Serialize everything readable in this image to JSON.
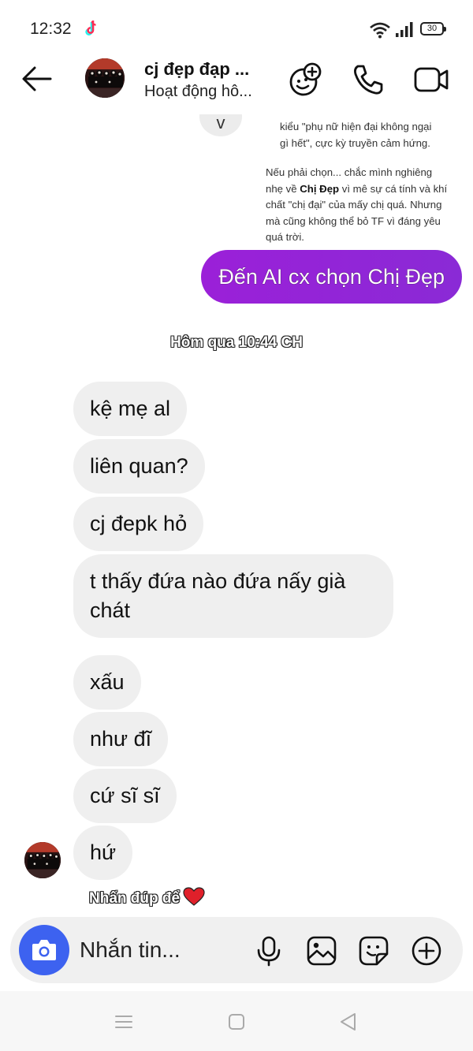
{
  "status_bar": {
    "time": "12:32",
    "battery": "30",
    "icons": [
      "tiktok-icon",
      "wifi-icon",
      "signal-icon",
      "battery-icon"
    ]
  },
  "header": {
    "contact_name": "cj đẹp đạp ...",
    "contact_status": "Hoạt động hô...",
    "icons": [
      "back-arrow-icon",
      "effects-icon",
      "phone-icon",
      "video-camera-icon"
    ]
  },
  "ai_message": {
    "para1_line1": "kiểu \"phụ nữ hiện đại không ngại",
    "para1_line2": "gì hết\", cực kỳ truyền cảm hứng.",
    "para2_part1": "Nếu phải chọn... chắc mình nghiêng nhẹ về ",
    "para2_bold": "Chị Đẹp",
    "para2_part2": " vì mê sự cá tính và khí chất \"chị đại\" của mấy chị quá. Nhưng mà cũng không thể bỏ TF vì đáng yêu quá trời."
  },
  "sent_message": "Đến AI cx chọn Chị Đẹp",
  "timestamp": "Hôm qua 10:44 CH",
  "received_messages": [
    "kệ mẹ al",
    "liên quan?",
    "cj đepk hỏ",
    "t thấy đứa nào đứa nấy già chát",
    "xấu",
    "như đĩ",
    "cứ sĩ sĩ",
    "hứ"
  ],
  "reaction_hint": "Nhấn đúp để",
  "composer": {
    "placeholder": "Nhắn tin...",
    "icons": [
      "camera-icon",
      "microphone-icon",
      "gallery-icon",
      "sticker-icon",
      "plus-icon"
    ]
  },
  "nav_bar": {
    "icons": [
      "menu-icon",
      "home-icon",
      "back-triangle-icon"
    ]
  },
  "colors": {
    "sent_bubble": "#9b20d8",
    "received_bubble": "#efefef",
    "camera_button": "#3d62f0",
    "heart": "#e0202a"
  }
}
